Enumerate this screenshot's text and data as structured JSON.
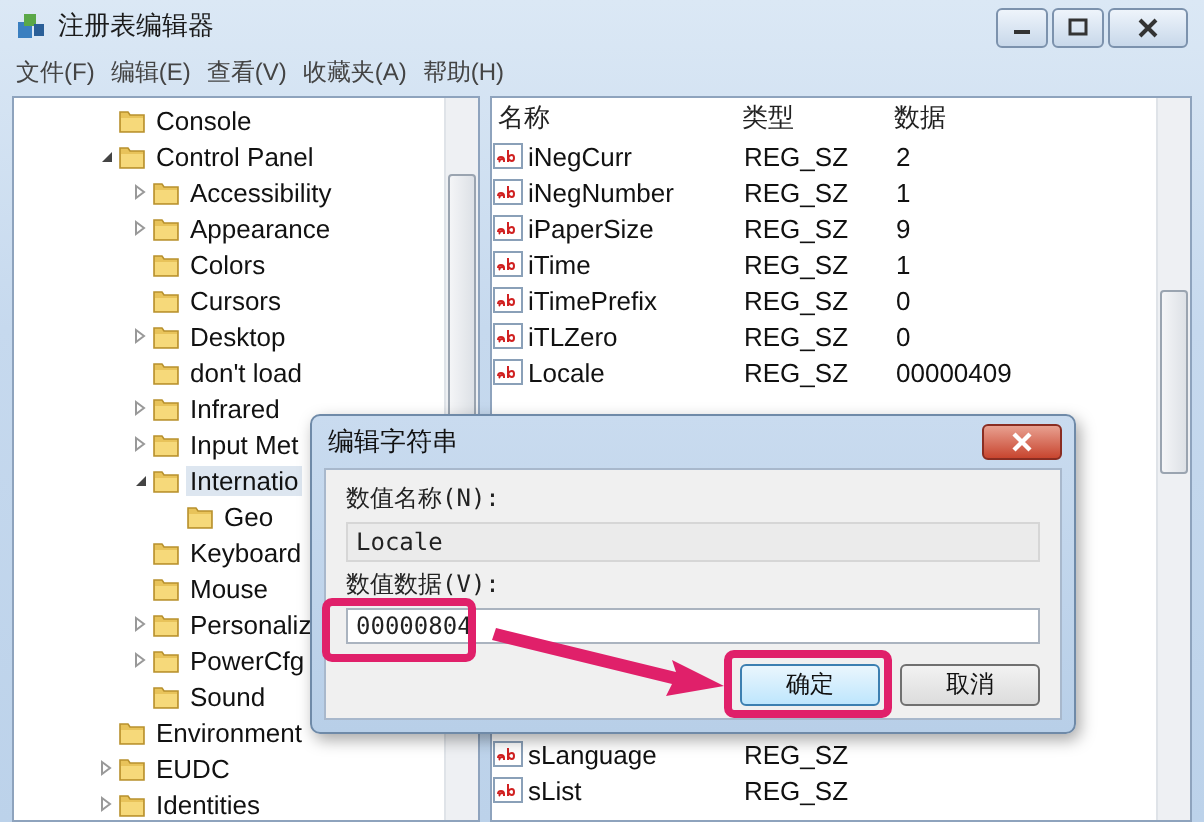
{
  "window": {
    "title": "注册表编辑器"
  },
  "menu": [
    "文件(F)",
    "编辑(E)",
    "查看(V)",
    "收藏夹(A)",
    "帮助(H)"
  ],
  "tree": [
    {
      "label": "Console",
      "selected": false
    },
    {
      "label": "Control Panel",
      "expanded": true,
      "selected": false,
      "children": [
        {
          "label": "Accessibility",
          "expanded": false,
          "selected": false
        },
        {
          "label": "Appearance",
          "expanded": false,
          "selected": false
        },
        {
          "label": "Colors",
          "selected": false
        },
        {
          "label": "Cursors",
          "selected": false
        },
        {
          "label": "Desktop",
          "expanded": false,
          "selected": false
        },
        {
          "label": "don't load",
          "selected": false
        },
        {
          "label": "Infrared",
          "expanded": false,
          "selected": false
        },
        {
          "label": "Input Met",
          "expanded": false,
          "selected": false
        },
        {
          "label": "Internatio",
          "expanded": true,
          "selected": true,
          "children": [
            {
              "label": "Geo",
              "selected": false
            }
          ]
        },
        {
          "label": "Keyboard",
          "selected": false
        },
        {
          "label": "Mouse",
          "selected": false
        },
        {
          "label": "Personaliz",
          "expanded": false,
          "selected": false
        },
        {
          "label": "PowerCfg",
          "expanded": false,
          "selected": false
        },
        {
          "label": "Sound",
          "selected": false
        }
      ]
    },
    {
      "label": "Environment",
      "selected": false
    },
    {
      "label": "EUDC",
      "expanded": false,
      "selected": false
    },
    {
      "label": "Identities",
      "expanded": false,
      "selected": false
    }
  ],
  "table": {
    "columns": [
      "名称",
      "类型",
      "数据"
    ],
    "rows_top": [
      {
        "name": "iNegCurr",
        "type": "REG_SZ",
        "data": "2"
      },
      {
        "name": "iNegNumber",
        "type": "REG_SZ",
        "data": "1"
      },
      {
        "name": "iPaperSize",
        "type": "REG_SZ",
        "data": "9"
      },
      {
        "name": "iTime",
        "type": "REG_SZ",
        "data": "1"
      },
      {
        "name": "iTimePrefix",
        "type": "REG_SZ",
        "data": "0"
      },
      {
        "name": "iTLZero",
        "type": "REG_SZ",
        "data": "0"
      },
      {
        "name": "Locale",
        "type": "REG_SZ",
        "data": "00000409"
      }
    ],
    "rows_bottom": [
      {
        "name": "sLanguage",
        "type": "REG_SZ"
      },
      {
        "name": "sList",
        "type": "REG_SZ"
      }
    ]
  },
  "dialog": {
    "title": "编辑字符串",
    "name_label": "数值名称(N):",
    "name_value": "Locale",
    "data_label": "数值数据(V):",
    "data_value": "00000804",
    "buttons": [
      {
        "label": "确定",
        "default": true
      },
      {
        "label": "取消",
        "default": false
      }
    ]
  }
}
